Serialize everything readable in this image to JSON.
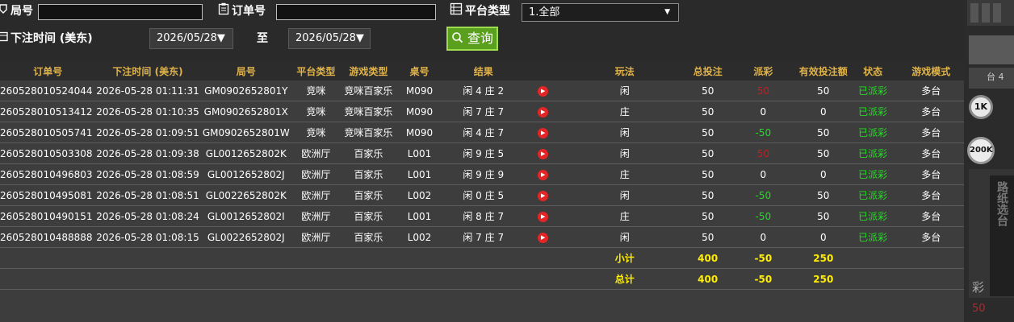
{
  "filters": {
    "round_label": "局号",
    "round_value": "",
    "order_label": "订单号",
    "order_value": "",
    "platform_label": "平台类型",
    "platform_selected": "1.全部",
    "bet_time_label": "下注时间 (美东)",
    "date_from": "2026/05/28▼",
    "to_label": "至",
    "date_to": "2026/05/28▼",
    "query_label": "查询"
  },
  "table": {
    "headers": [
      "订单号",
      "下注时间 (美东)",
      "局号",
      "平台类型",
      "游戏类型",
      "桌号",
      "结果",
      "",
      "玩法",
      "总投注",
      "派彩",
      "有效投注额",
      "状态",
      "游戏模式"
    ],
    "rows": [
      {
        "order": "260528010524044",
        "time": "2026-05-28 01:11:31",
        "round": "GM0902652801Y",
        "platform": "竞咪",
        "game": "竞咪百家乐",
        "table": "M090",
        "result": "闲 4 庄 2",
        "play": "闲",
        "total": "50",
        "payout": "50",
        "payout_color": "red",
        "valid": "50",
        "status": "已派彩",
        "mode": "多台"
      },
      {
        "order": "260528010513412",
        "time": "2026-05-28 01:10:35",
        "round": "GM0902652801X",
        "platform": "竞咪",
        "game": "竞咪百家乐",
        "table": "M090",
        "result": "闲 7 庄 7",
        "play": "庄",
        "total": "50",
        "payout": "0",
        "payout_color": "white",
        "valid": "0",
        "status": "已派彩",
        "mode": "多台"
      },
      {
        "order": "260528010505741",
        "time": "2026-05-28 01:09:51",
        "round": "GM0902652801W",
        "platform": "竞咪",
        "game": "竞咪百家乐",
        "table": "M090",
        "result": "闲 4 庄 7",
        "play": "闲",
        "total": "50",
        "payout": "-50",
        "payout_color": "green",
        "valid": "50",
        "status": "已派彩",
        "mode": "多台"
      },
      {
        "order": "260528010503308",
        "time": "2026-05-28 01:09:38",
        "round": "GL0012652802K",
        "platform": "欧洲厅",
        "game": "百家乐",
        "table": "L001",
        "result": "闲 9 庄 5",
        "play": "闲",
        "total": "50",
        "payout": "50",
        "payout_color": "red",
        "valid": "50",
        "status": "已派彩",
        "mode": "多台"
      },
      {
        "order": "260528010496803",
        "time": "2026-05-28 01:08:59",
        "round": "GL0012652802J",
        "platform": "欧洲厅",
        "game": "百家乐",
        "table": "L001",
        "result": "闲 9 庄 9",
        "play": "庄",
        "total": "50",
        "payout": "0",
        "payout_color": "white",
        "valid": "0",
        "status": "已派彩",
        "mode": "多台"
      },
      {
        "order": "260528010495081",
        "time": "2026-05-28 01:08:51",
        "round": "GL0022652802K",
        "platform": "欧洲厅",
        "game": "百家乐",
        "table": "L002",
        "result": "闲 0 庄 5",
        "play": "闲",
        "total": "50",
        "payout": "-50",
        "payout_color": "green",
        "valid": "50",
        "status": "已派彩",
        "mode": "多台"
      },
      {
        "order": "260528010490151",
        "time": "2026-05-28 01:08:24",
        "round": "GL0012652802I",
        "platform": "欧洲厅",
        "game": "百家乐",
        "table": "L001",
        "result": "闲 8 庄 7",
        "play": "庄",
        "total": "50",
        "payout": "-50",
        "payout_color": "green",
        "valid": "50",
        "status": "已派彩",
        "mode": "多台"
      },
      {
        "order": "260528010488888",
        "time": "2026-05-28 01:08:15",
        "round": "GL0022652802J",
        "platform": "欧洲厅",
        "game": "百家乐",
        "table": "L002",
        "result": "闲 7 庄 7",
        "play": "闲",
        "total": "50",
        "payout": "0",
        "payout_color": "white",
        "valid": "0",
        "status": "已派彩",
        "mode": "多台"
      }
    ],
    "subtotal": {
      "label": "小计",
      "total": "400",
      "payout": "-50",
      "valid": "250"
    },
    "grandtotal": {
      "label": "总计",
      "total": "400",
      "payout": "-50",
      "valid": "250"
    }
  },
  "side_panel": {
    "table_tag": "台 4",
    "chip_1": "1K",
    "chip_2": "200K",
    "vertical_text": "路纸选台",
    "partial_glyph": "彩",
    "partial_number": "50"
  },
  "colors": {
    "header_gold": "#e0b34a",
    "total_yellow": "#ffee00",
    "status_green": "#22dd22",
    "payout_red": "#cc1a1a",
    "query_green": "#5aa01e"
  }
}
